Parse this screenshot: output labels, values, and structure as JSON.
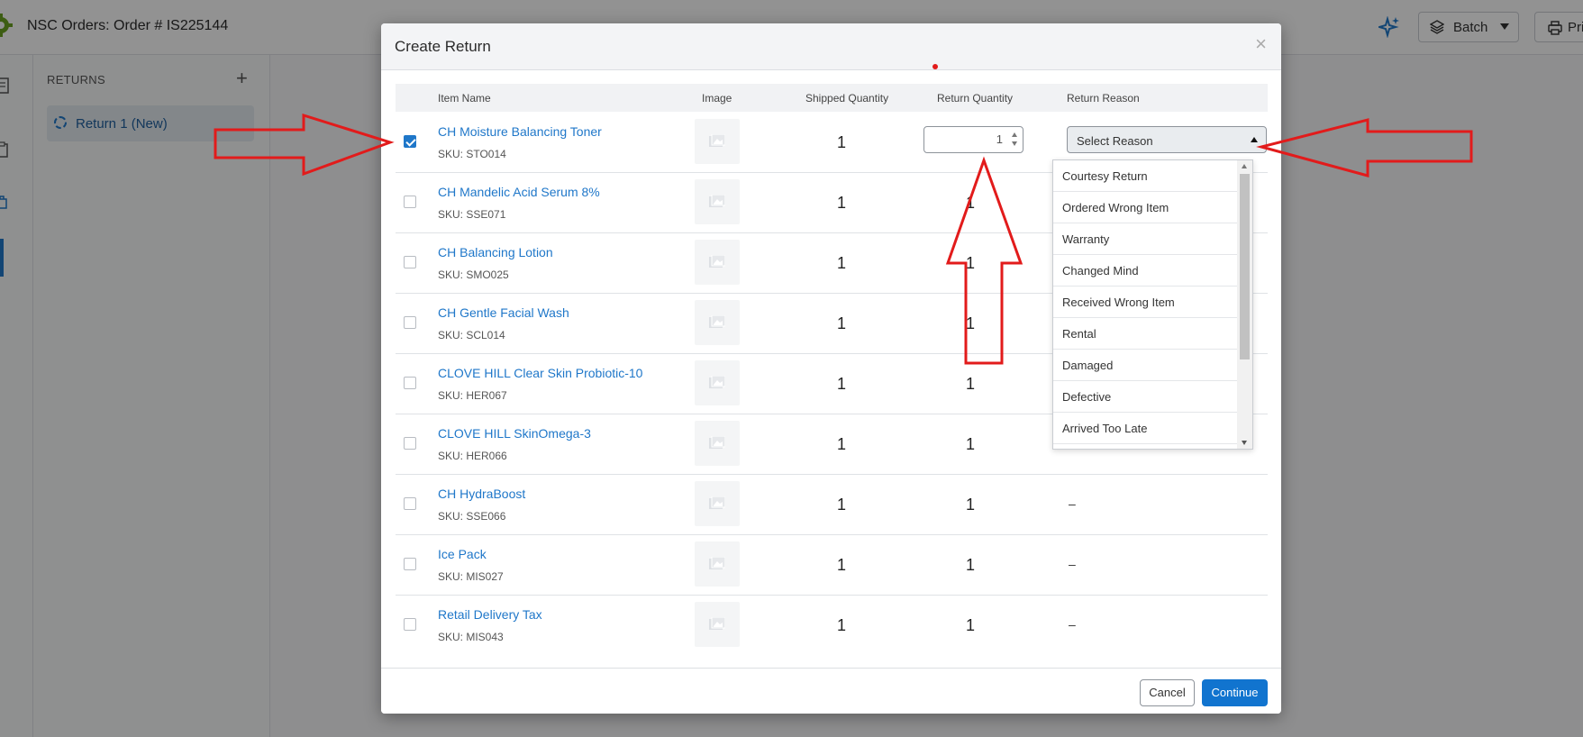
{
  "app": {
    "title": "NSC Orders:  Order # IS225144",
    "batch_label": "Batch",
    "print_label": "Pri"
  },
  "returns_panel": {
    "heading": "RETURNS",
    "add_symbol": "+",
    "items": [
      {
        "label": "Return 1 (New)"
      }
    ]
  },
  "modal": {
    "title": "Create Return",
    "close_symbol": "×",
    "columns": [
      "Item Name",
      "Image",
      "Shipped Quantity",
      "Return Quantity",
      "Return Reason"
    ],
    "rows": [
      {
        "name": "CH Moisture Balancing Toner",
        "sku": "SKU: STO014",
        "shipped": "1",
        "return_qty": "1",
        "reason": "",
        "checked": true
      },
      {
        "name": "CH Mandelic Acid Serum 8%",
        "sku": "SKU: SSE071",
        "shipped": "1",
        "return_qty": "1",
        "reason": "",
        "checked": false
      },
      {
        "name": "CH Balancing Lotion",
        "sku": "SKU: SMO025",
        "shipped": "1",
        "return_qty": "1",
        "reason": "",
        "checked": false
      },
      {
        "name": "CH Gentle Facial Wash",
        "sku": "SKU: SCL014",
        "shipped": "1",
        "return_qty": "1",
        "reason": "",
        "checked": false
      },
      {
        "name": "CLOVE HILL Clear Skin Probiotic-10",
        "sku": "SKU: HER067",
        "shipped": "1",
        "return_qty": "1",
        "reason": "",
        "checked": false
      },
      {
        "name": "CLOVE HILL SkinOmega-3",
        "sku": "SKU: HER066",
        "shipped": "1",
        "return_qty": "1",
        "reason": "",
        "checked": false
      },
      {
        "name": "CH HydraBoost",
        "sku": "SKU: SSE066",
        "shipped": "1",
        "return_qty": "1",
        "reason": "–",
        "checked": false
      },
      {
        "name": "Ice Pack",
        "sku": "SKU: MIS027",
        "shipped": "1",
        "return_qty": "1",
        "reason": "–",
        "checked": false
      },
      {
        "name": "Retail Delivery Tax",
        "sku": "SKU: MIS043",
        "shipped": "1",
        "return_qty": "1",
        "reason": "–",
        "checked": false
      }
    ],
    "select_placeholder": "Select Reason",
    "reason_options": [
      "Courtesy Return",
      "Ordered Wrong Item",
      "Warranty",
      "Changed Mind",
      "Received Wrong Item",
      "Rental",
      "Damaged",
      "Defective",
      "Arrived Too Late"
    ],
    "cancel_label": "Cancel",
    "continue_label": "Continue"
  },
  "colors": {
    "accent": "#1174cf",
    "link": "#1f77c9",
    "annotation_arrow": "#e21b1b"
  }
}
